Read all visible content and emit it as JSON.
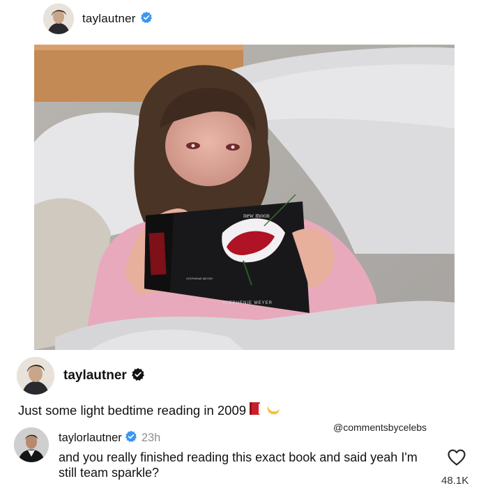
{
  "post": {
    "username": "taylautner",
    "caption": "Just some light bedtime reading in 2009",
    "caption_emojis": [
      "red-book-icon",
      "crescent-moon-icon"
    ],
    "book": {
      "title": "new moon",
      "author": "STEPHENIE MEYER",
      "spine_author": "STEPHENIE MEYER"
    }
  },
  "watermark": "@commentsbycelebs",
  "comment": {
    "username": "taylorlautner",
    "time": "23h",
    "text": "and you really finished reading this exact book and said yeah I'm still team sparkle?",
    "likes": "48.1K"
  },
  "colors": {
    "verified_blue": "#3897f0",
    "verified_black": "#111111",
    "text_primary": "#111111",
    "text_secondary": "#8e8e8e"
  }
}
